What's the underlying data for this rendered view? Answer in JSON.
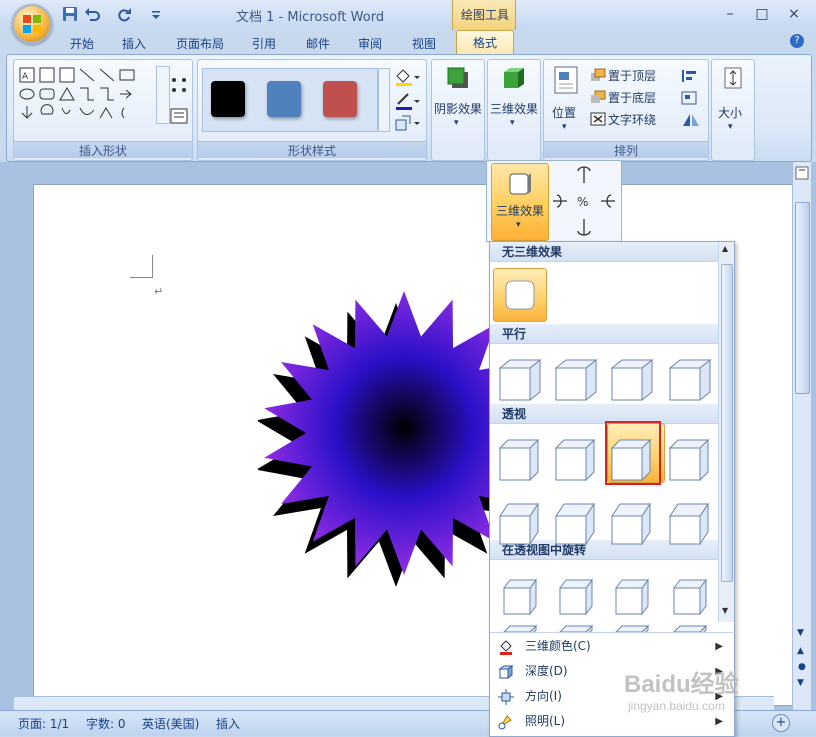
{
  "window": {
    "title": "文档 1 - Microsoft Word",
    "context_tab_group": "绘图工具",
    "minimize": "–",
    "maximize": "□",
    "close": "×"
  },
  "qat": {
    "save_icon": "save-icon",
    "undo_icon": "undo-icon",
    "redo_icon": "redo-icon",
    "more_icon": "dropdown-icon"
  },
  "tabs": [
    {
      "label": "开始"
    },
    {
      "label": "插入"
    },
    {
      "label": "页面布局"
    },
    {
      "label": "引用"
    },
    {
      "label": "邮件"
    },
    {
      "label": "审阅"
    },
    {
      "label": "视图"
    },
    {
      "label": "格式",
      "active": true
    }
  ],
  "ribbon": {
    "insert_shapes": {
      "label": "插入形状"
    },
    "shape_styles": {
      "label": "形状样式",
      "swatches": [
        "#000000",
        "#4f81bd",
        "#c0504d"
      ]
    },
    "shadow_effects": {
      "label": "阴影效果"
    },
    "effects_3d": {
      "label": "三维效果"
    },
    "arrange": {
      "label": "排列",
      "position": "位置",
      "bring_front": "置于顶层",
      "send_back": "置于底层",
      "text_wrap": "文字环绕"
    },
    "size": {
      "label": "大小"
    }
  },
  "flyout": {
    "effects_3d_button": "三维效果"
  },
  "gallery": {
    "sections": [
      {
        "title": "无三维效果"
      },
      {
        "title": "平行"
      },
      {
        "title": "透视"
      },
      {
        "title": "在透视图中旋转"
      }
    ],
    "menu": [
      {
        "label": "三维颜色(C)",
        "icon": "paint-bucket-icon"
      },
      {
        "label": "深度(D)",
        "icon": "depth-icon"
      },
      {
        "label": "方向(I)",
        "icon": "direction-icon"
      },
      {
        "label": "照明(L)",
        "icon": "lighting-icon"
      }
    ]
  },
  "status": {
    "page": "页面: 1/1",
    "words": "字数: 0",
    "language": "英语(美国)",
    "mode": "插入"
  },
  "document": {
    "paragraph_mark": "↵"
  },
  "watermark": {
    "text": "Baidu经验",
    "url": "jingyan.baidu.com"
  },
  "colors": {
    "accent": "#fbb037",
    "selection_outline": "#e02020",
    "star_center": "#000000",
    "star_mid": "#2a10c8",
    "star_edge": "#8a2be2"
  }
}
